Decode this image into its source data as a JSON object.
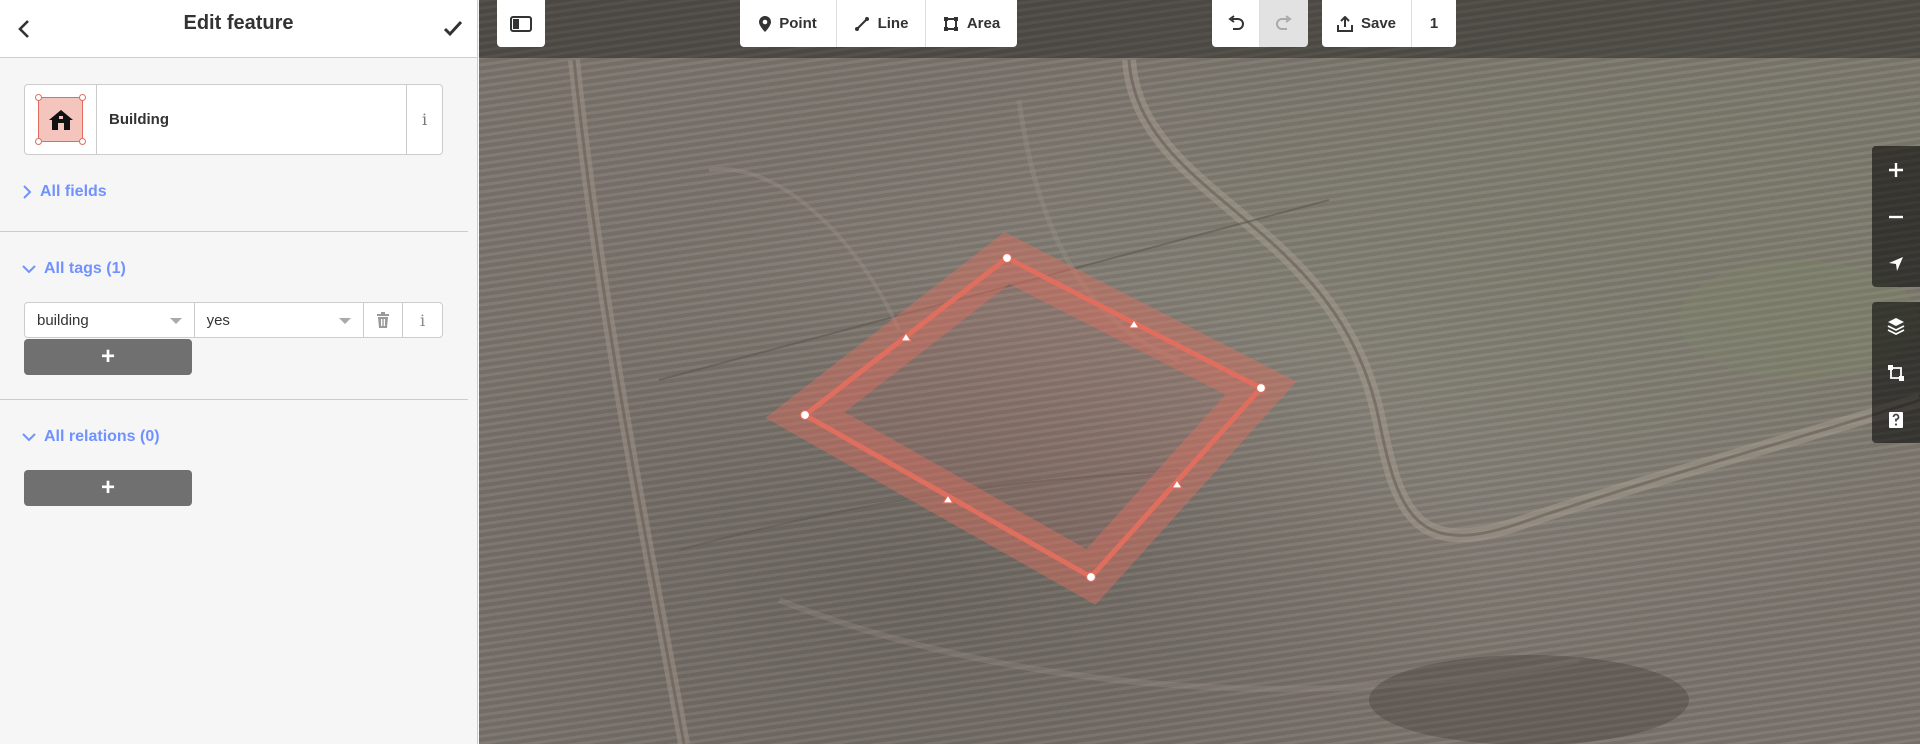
{
  "sidebar": {
    "title": "Edit feature",
    "preset": {
      "name": "Building",
      "icon": "building-icon",
      "info": "i"
    },
    "all_fields_label": "All fields",
    "all_tags_label": "All tags (1)",
    "tags": [
      {
        "key": "building",
        "value": "yes"
      }
    ],
    "all_relations_label": "All relations (0)",
    "add_label": "+"
  },
  "toolbar": {
    "point_label": "Point",
    "line_label": "Line",
    "area_label": "Area",
    "save_label": "Save",
    "save_count": "1"
  },
  "colors": {
    "accent": "#7092ff",
    "area_stroke": "#e06e5f",
    "button_dark": "#707070"
  }
}
